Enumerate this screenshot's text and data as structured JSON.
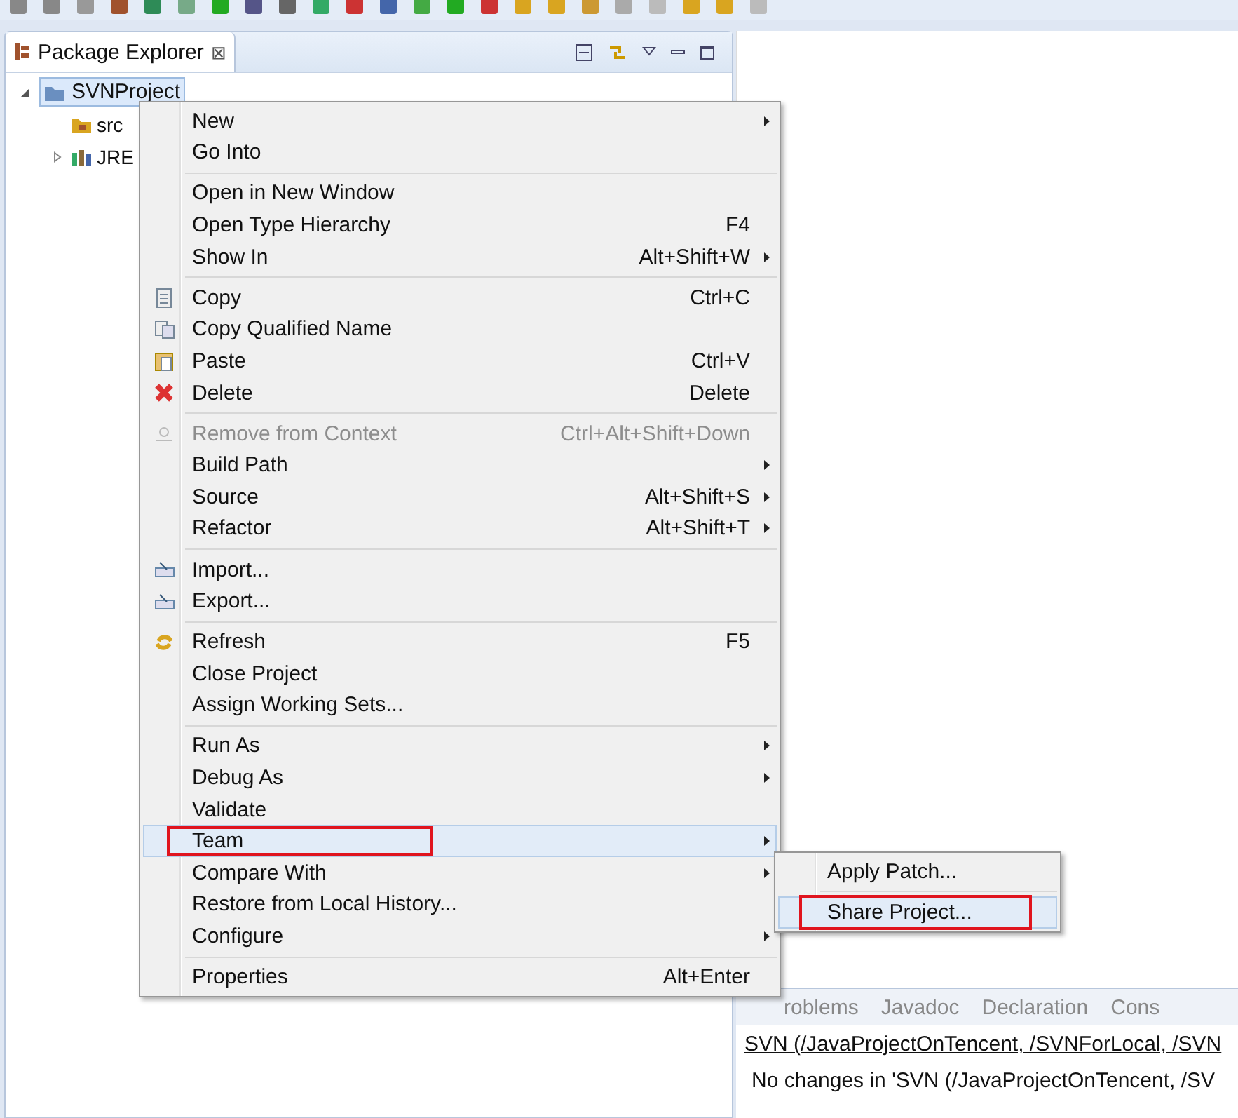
{
  "view": {
    "title": "Package Explorer",
    "close": "⊠"
  },
  "tree": [
    {
      "label": "SVNProject",
      "kind": "project",
      "selected": true,
      "expanded": true,
      "children": [
        {
          "label": "src",
          "kind": "folder",
          "selected": false
        },
        {
          "label": "JRE",
          "kind": "library",
          "selected": false,
          "expanded": false
        }
      ]
    }
  ],
  "context_menu": {
    "groups": [
      [
        {
          "label": "New",
          "submenu": true
        },
        {
          "label": "Go Into"
        }
      ],
      [
        {
          "label": "Open in New Window"
        },
        {
          "label": "Open Type Hierarchy",
          "shortcut": "F4"
        },
        {
          "label": "Show In",
          "shortcut": "Alt+Shift+W",
          "submenu": true
        }
      ],
      [
        {
          "label": "Copy",
          "shortcut": "Ctrl+C",
          "kind": "copy"
        },
        {
          "label": "Copy Qualified Name",
          "kind": "copy-name"
        },
        {
          "label": "Paste",
          "shortcut": "Ctrl+V",
          "kind": "paste"
        },
        {
          "label": "Delete",
          "shortcut": "Delete",
          "kind": "delete"
        }
      ],
      [
        {
          "label": "Remove from Context",
          "shortcut": "Ctrl+Alt+Shift+Down",
          "kind": "context",
          "disabled": true
        },
        {
          "label": "Build Path",
          "submenu": true
        },
        {
          "label": "Source",
          "shortcut": "Alt+Shift+S",
          "submenu": true
        },
        {
          "label": "Refactor",
          "shortcut": "Alt+Shift+T",
          "submenu": true
        }
      ],
      [
        {
          "label": "Import...",
          "kind": "import"
        },
        {
          "label": "Export...",
          "kind": "export"
        }
      ],
      [
        {
          "label": "Refresh",
          "shortcut": "F5",
          "kind": "refresh"
        },
        {
          "label": "Close Project"
        },
        {
          "label": "Assign Working Sets..."
        }
      ],
      [
        {
          "label": "Run As",
          "submenu": true
        },
        {
          "label": "Debug As",
          "submenu": true
        },
        {
          "label": "Validate"
        },
        {
          "label": "Team",
          "submenu": true,
          "selected": true,
          "highlighted": true
        },
        {
          "label": "Compare With",
          "submenu": true
        },
        {
          "label": "Restore from Local History..."
        },
        {
          "label": "Configure",
          "submenu": true
        }
      ],
      [
        {
          "label": "Properties",
          "shortcut": "Alt+Enter"
        }
      ]
    ]
  },
  "submenu": {
    "groups": [
      [
        {
          "label": "Apply Patch..."
        }
      ],
      [
        {
          "label": "Share Project...",
          "selected": true,
          "highlighted": true
        }
      ]
    ]
  },
  "bottom_panel": {
    "tabs": [
      {
        "label": "roblems"
      },
      {
        "label": "Javadoc"
      },
      {
        "label": "Declaration"
      },
      {
        "label": "Cons"
      }
    ],
    "heading": "SVN (/JavaProjectOnTencent, /SVNForLocal, /SVN",
    "message": "No changes in 'SVN (/JavaProjectOnTencent, /SV"
  }
}
